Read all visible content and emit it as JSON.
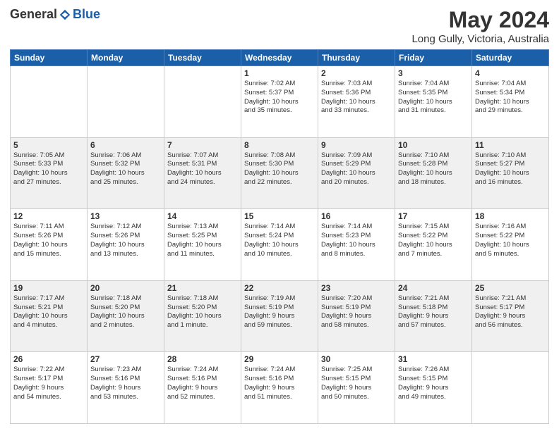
{
  "header": {
    "logo_general": "General",
    "logo_blue": "Blue",
    "title": "May 2024",
    "location": "Long Gully, Victoria, Australia"
  },
  "weekdays": [
    "Sunday",
    "Monday",
    "Tuesday",
    "Wednesday",
    "Thursday",
    "Friday",
    "Saturday"
  ],
  "weeks": [
    [
      {
        "day": "",
        "info": ""
      },
      {
        "day": "",
        "info": ""
      },
      {
        "day": "",
        "info": ""
      },
      {
        "day": "1",
        "info": "Sunrise: 7:02 AM\nSunset: 5:37 PM\nDaylight: 10 hours\nand 35 minutes."
      },
      {
        "day": "2",
        "info": "Sunrise: 7:03 AM\nSunset: 5:36 PM\nDaylight: 10 hours\nand 33 minutes."
      },
      {
        "day": "3",
        "info": "Sunrise: 7:04 AM\nSunset: 5:35 PM\nDaylight: 10 hours\nand 31 minutes."
      },
      {
        "day": "4",
        "info": "Sunrise: 7:04 AM\nSunset: 5:34 PM\nDaylight: 10 hours\nand 29 minutes."
      }
    ],
    [
      {
        "day": "5",
        "info": "Sunrise: 7:05 AM\nSunset: 5:33 PM\nDaylight: 10 hours\nand 27 minutes."
      },
      {
        "day": "6",
        "info": "Sunrise: 7:06 AM\nSunset: 5:32 PM\nDaylight: 10 hours\nand 25 minutes."
      },
      {
        "day": "7",
        "info": "Sunrise: 7:07 AM\nSunset: 5:31 PM\nDaylight: 10 hours\nand 24 minutes."
      },
      {
        "day": "8",
        "info": "Sunrise: 7:08 AM\nSunset: 5:30 PM\nDaylight: 10 hours\nand 22 minutes."
      },
      {
        "day": "9",
        "info": "Sunrise: 7:09 AM\nSunset: 5:29 PM\nDaylight: 10 hours\nand 20 minutes."
      },
      {
        "day": "10",
        "info": "Sunrise: 7:10 AM\nSunset: 5:28 PM\nDaylight: 10 hours\nand 18 minutes."
      },
      {
        "day": "11",
        "info": "Sunrise: 7:10 AM\nSunset: 5:27 PM\nDaylight: 10 hours\nand 16 minutes."
      }
    ],
    [
      {
        "day": "12",
        "info": "Sunrise: 7:11 AM\nSunset: 5:26 PM\nDaylight: 10 hours\nand 15 minutes."
      },
      {
        "day": "13",
        "info": "Sunrise: 7:12 AM\nSunset: 5:26 PM\nDaylight: 10 hours\nand 13 minutes."
      },
      {
        "day": "14",
        "info": "Sunrise: 7:13 AM\nSunset: 5:25 PM\nDaylight: 10 hours\nand 11 minutes."
      },
      {
        "day": "15",
        "info": "Sunrise: 7:14 AM\nSunset: 5:24 PM\nDaylight: 10 hours\nand 10 minutes."
      },
      {
        "day": "16",
        "info": "Sunrise: 7:14 AM\nSunset: 5:23 PM\nDaylight: 10 hours\nand 8 minutes."
      },
      {
        "day": "17",
        "info": "Sunrise: 7:15 AM\nSunset: 5:22 PM\nDaylight: 10 hours\nand 7 minutes."
      },
      {
        "day": "18",
        "info": "Sunrise: 7:16 AM\nSunset: 5:22 PM\nDaylight: 10 hours\nand 5 minutes."
      }
    ],
    [
      {
        "day": "19",
        "info": "Sunrise: 7:17 AM\nSunset: 5:21 PM\nDaylight: 10 hours\nand 4 minutes."
      },
      {
        "day": "20",
        "info": "Sunrise: 7:18 AM\nSunset: 5:20 PM\nDaylight: 10 hours\nand 2 minutes."
      },
      {
        "day": "21",
        "info": "Sunrise: 7:18 AM\nSunset: 5:20 PM\nDaylight: 10 hours\nand 1 minute."
      },
      {
        "day": "22",
        "info": "Sunrise: 7:19 AM\nSunset: 5:19 PM\nDaylight: 9 hours\nand 59 minutes."
      },
      {
        "day": "23",
        "info": "Sunrise: 7:20 AM\nSunset: 5:19 PM\nDaylight: 9 hours\nand 58 minutes."
      },
      {
        "day": "24",
        "info": "Sunrise: 7:21 AM\nSunset: 5:18 PM\nDaylight: 9 hours\nand 57 minutes."
      },
      {
        "day": "25",
        "info": "Sunrise: 7:21 AM\nSunset: 5:17 PM\nDaylight: 9 hours\nand 56 minutes."
      }
    ],
    [
      {
        "day": "26",
        "info": "Sunrise: 7:22 AM\nSunset: 5:17 PM\nDaylight: 9 hours\nand 54 minutes."
      },
      {
        "day": "27",
        "info": "Sunrise: 7:23 AM\nSunset: 5:16 PM\nDaylight: 9 hours\nand 53 minutes."
      },
      {
        "day": "28",
        "info": "Sunrise: 7:24 AM\nSunset: 5:16 PM\nDaylight: 9 hours\nand 52 minutes."
      },
      {
        "day": "29",
        "info": "Sunrise: 7:24 AM\nSunset: 5:16 PM\nDaylight: 9 hours\nand 51 minutes."
      },
      {
        "day": "30",
        "info": "Sunrise: 7:25 AM\nSunset: 5:15 PM\nDaylight: 9 hours\nand 50 minutes."
      },
      {
        "day": "31",
        "info": "Sunrise: 7:26 AM\nSunset: 5:15 PM\nDaylight: 9 hours\nand 49 minutes."
      },
      {
        "day": "",
        "info": ""
      }
    ]
  ]
}
